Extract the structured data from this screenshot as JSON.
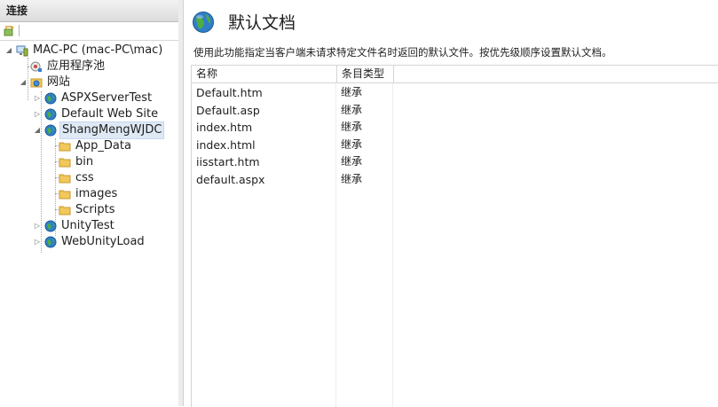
{
  "connections_panel": {
    "header": "连接"
  },
  "tree": {
    "server": "MAC-PC (mac-PC\\mac)",
    "app_pools": "应用程序池",
    "sites": "网站",
    "site_items": [
      {
        "label": "ASPXServerTest"
      },
      {
        "label": "Default Web Site"
      },
      {
        "label": "ShangMengWJDC",
        "selected": true
      },
      {
        "label": "UnityTest"
      },
      {
        "label": "WebUnityLoad"
      }
    ],
    "folders": [
      "App_Data",
      "bin",
      "css",
      "images",
      "Scripts"
    ]
  },
  "main": {
    "title": "默认文档",
    "description": "使用此功能指定当客户端未请求特定文件名时返回的默认文件。按优先级顺序设置默认文档。",
    "columns": {
      "name": "名称",
      "type": "条目类型"
    },
    "rows": [
      {
        "name": "Default.htm",
        "type": "继承"
      },
      {
        "name": "Default.asp",
        "type": "继承"
      },
      {
        "name": "index.htm",
        "type": "继承"
      },
      {
        "name": "index.html",
        "type": "继承"
      },
      {
        "name": "iisstart.htm",
        "type": "继承"
      },
      {
        "name": "default.aspx",
        "type": "继承"
      }
    ]
  },
  "colors": {
    "header_bg": "#dcdcdc",
    "selection_bg": "#dfe9f5",
    "folder": "#f2c75c",
    "globe": "#2f7fc8"
  }
}
